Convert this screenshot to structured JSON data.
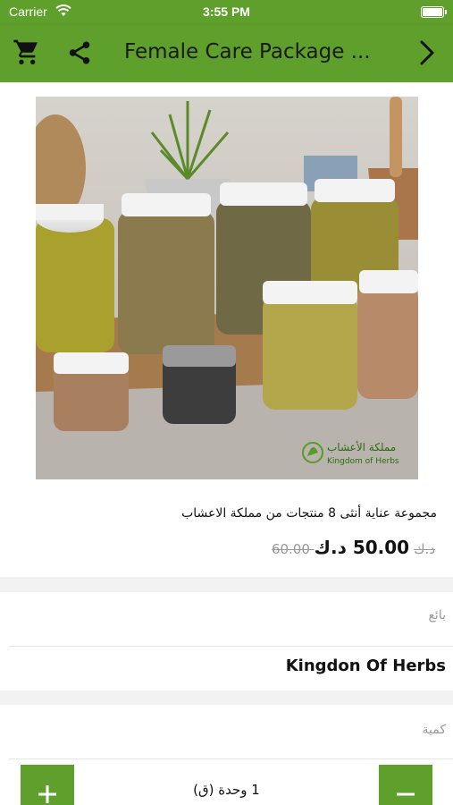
{
  "status_bar": {
    "carrier": "Carrier",
    "time": "3:55 PM"
  },
  "nav": {
    "title": "Female Care Package ...",
    "icons": {
      "cart": "cart-icon",
      "share": "share-icon",
      "next": "chevron-right-icon"
    }
  },
  "product": {
    "name": "مجموعة عناية أنثى 8 منتجات من مملكة الاعشاب",
    "old_price": "60.00 د.ك",
    "new_price": "50.00 د.ك",
    "image_logo_ar": "مملكة الأعشاب",
    "image_logo_en": "Kingdom of Herbs"
  },
  "seller": {
    "label": "بائع",
    "name": "Kingdon Of Herbs"
  },
  "quantity": {
    "label": "كمية",
    "value": "1 وحدة (ق)"
  },
  "colors": {
    "brand_green": "#5f9f2c",
    "title_text": "#1a1a1a",
    "muted_text": "#999999"
  }
}
